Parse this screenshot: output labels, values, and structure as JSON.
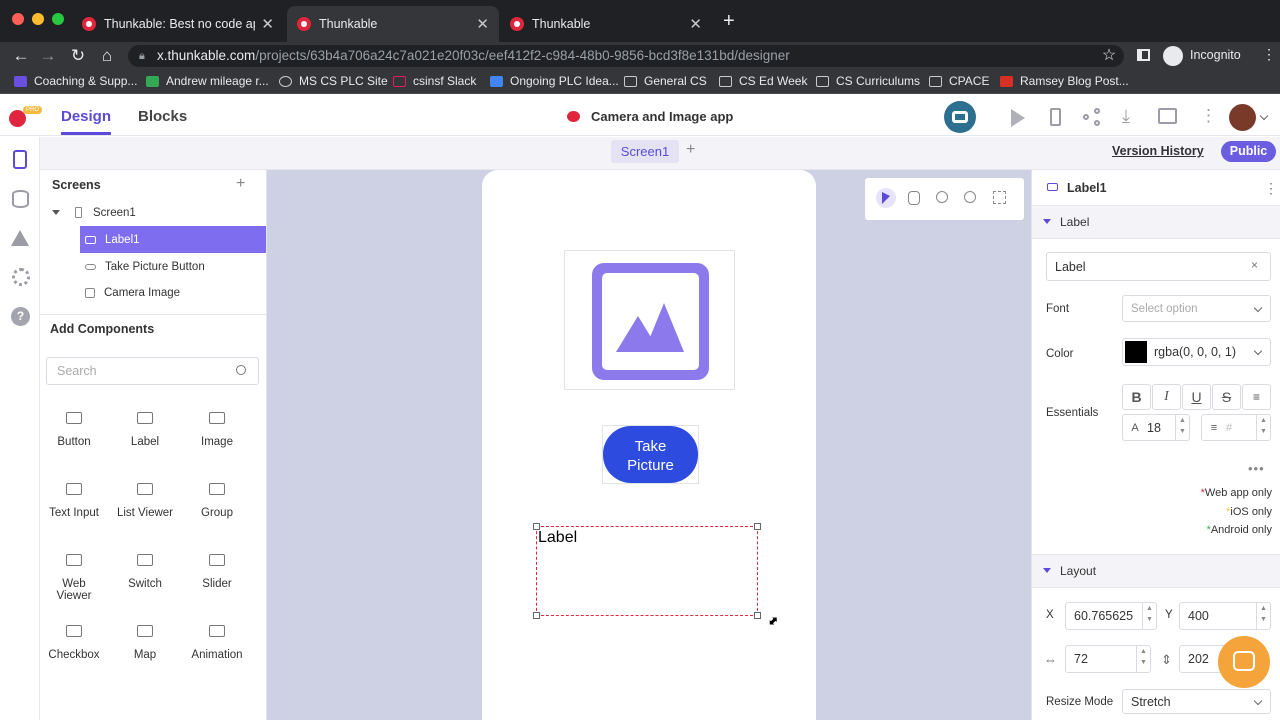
{
  "browser": {
    "tabs": [
      {
        "title": "Thunkable: Best no code app b"
      },
      {
        "title": "Thunkable"
      },
      {
        "title": "Thunkable"
      }
    ],
    "url_host": "x.thunkable.com",
    "url_path": "/projects/63b4a706a24c7a021e20f03c/eef412f2-c984-48b0-9856-bcd3f8e131bd/designer",
    "profile_label": "Incognito",
    "bookmarks": [
      "Coaching & Supp...",
      "Andrew mileage r...",
      "MS CS PLC Site",
      "csinsf Slack",
      "Ongoing PLC Idea...",
      "General CS",
      "CS Ed Week",
      "CS Curriculums",
      "CPACE",
      "Ramsey Blog Post..."
    ]
  },
  "header": {
    "pro_badge": "PRO",
    "tab_design": "Design",
    "tab_blocks": "Blocks",
    "project_title": "Camera and Image app"
  },
  "subbar": {
    "screen_tab": "Screen1",
    "add_screen": "+",
    "version_history": "Version History",
    "public_label": "Public"
  },
  "screens_panel": {
    "title": "Screens",
    "add": "+",
    "items": [
      {
        "label": "Screen1"
      },
      {
        "label": "Label1"
      },
      {
        "label": "Take Picture Button"
      },
      {
        "label": "Camera Image"
      }
    ]
  },
  "components_panel": {
    "title": "Add Components",
    "search_placeholder": "Search",
    "items": [
      {
        "label": "Button",
        "icon": "button-icon"
      },
      {
        "label": "Label",
        "icon": "label-icon"
      },
      {
        "label": "Image",
        "icon": "image-icon"
      },
      {
        "label": "Text Input",
        "icon": "text-input-icon"
      },
      {
        "label": "List Viewer",
        "icon": "list-icon"
      },
      {
        "label": "Group",
        "icon": "group-icon"
      },
      {
        "label": "Web Viewer",
        "icon": "web-viewer-icon"
      },
      {
        "label": "Switch",
        "icon": "switch-icon"
      },
      {
        "label": "Slider",
        "icon": "slider-icon"
      },
      {
        "label": "Checkbox",
        "icon": "checkbox-icon"
      },
      {
        "label": "Map",
        "icon": "map-icon"
      },
      {
        "label": "Animation",
        "icon": "animation-icon"
      }
    ]
  },
  "phone": {
    "button_label": "Take Picture",
    "label_text": "Label"
  },
  "properties": {
    "component_name": "Label1",
    "section_label": "Label",
    "text_value": "Label",
    "clear": "×",
    "font_label": "Font",
    "font_placeholder": "Select option",
    "color_label": "Color",
    "color_value": "rgba(0, 0, 0, 1)",
    "essentials_label": "Essentials",
    "font_size": "18",
    "line_height_placeholder": "#",
    "platform_notes": [
      "Web app only",
      "iOS only",
      "Android only"
    ],
    "layout_section": "Layout",
    "x_label": "X",
    "x_value": "60.765625",
    "y_label": "Y",
    "y_value": "400",
    "width_value": "72",
    "height_value": "202",
    "resize_mode_label": "Resize Mode",
    "resize_mode_value": "Stretch"
  },
  "colors": {
    "accent": "#5b4bd8",
    "selection": "#7f6df0",
    "take_picture_button": "#2e4be0",
    "canvas_bg": "#ced1e3"
  }
}
